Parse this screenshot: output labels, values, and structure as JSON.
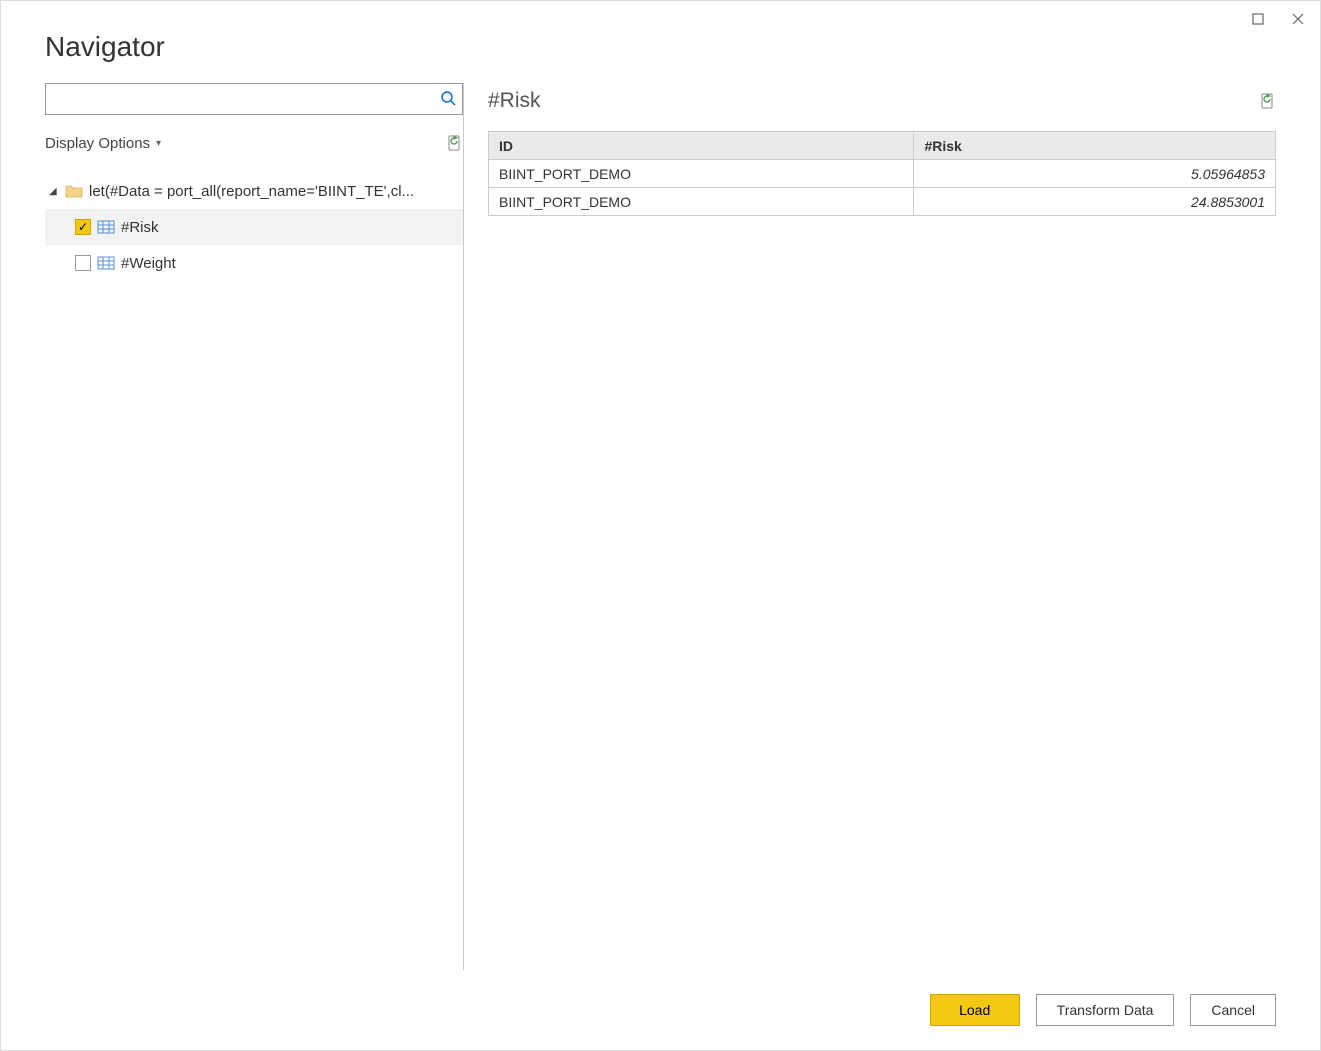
{
  "window": {
    "title": "Navigator"
  },
  "left": {
    "search": {
      "placeholder": ""
    },
    "display_options_label": "Display Options",
    "tree": {
      "root_label": "let(#Data = port_all(report_name='BIINT_TE',cl...",
      "items": [
        {
          "label": "#Risk",
          "checked": true
        },
        {
          "label": "#Weight",
          "checked": false
        }
      ]
    }
  },
  "preview": {
    "title": "#Risk",
    "columns": [
      "ID",
      "#Risk"
    ],
    "rows": [
      {
        "id": "BIINT_PORT_DEMO",
        "risk": "5.05964853"
      },
      {
        "id": "BIINT_PORT_DEMO",
        "risk": "24.8853001"
      }
    ]
  },
  "footer": {
    "load": "Load",
    "transform": "Transform Data",
    "cancel": "Cancel"
  }
}
